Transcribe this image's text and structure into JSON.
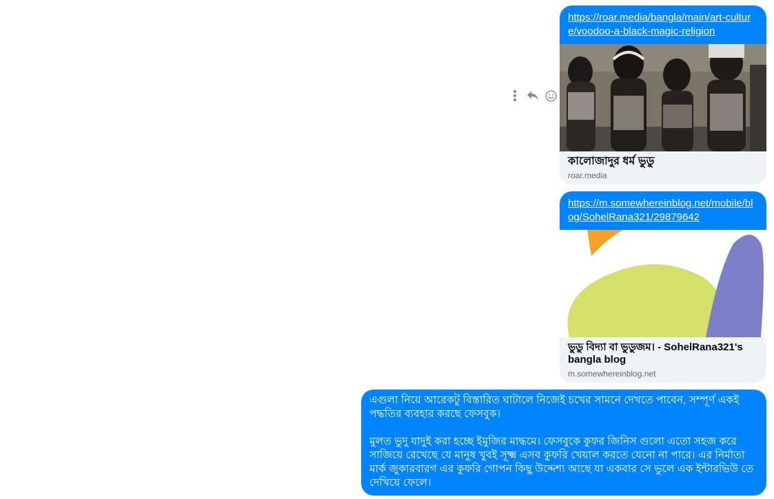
{
  "colors": {
    "bubble_blue": "#0084ff",
    "card_background": "#f0f2f5",
    "title_text": "#050505",
    "muted_text": "#65676b",
    "action_icon": "#8a8d91"
  },
  "message_actions": {
    "icons": [
      "more-options-icon",
      "reply-icon",
      "react-emoji-icon"
    ]
  },
  "messages": [
    {
      "type": "link_card",
      "url": "https://roar.media/bangla/main/art-culture/voodoo-a-black-magic-religion",
      "image": "voodoo-figurines-photo",
      "title": "কালোজাদুর ধর্ম ভুডু",
      "domain": "roar.media"
    },
    {
      "type": "link_card",
      "url": "https://m.somewhereinblog.net/mobile/blog/SohelRana321/29879642",
      "image": "somewhereinblog-logo-graphic",
      "title": "ভুডু বিদ্যা বা ভুডুজম। - SohelRana321's bangla blog",
      "domain": "m.somewhereinblog.net"
    },
    {
      "type": "text",
      "paragraphs": [
        "এগুলা নিয়ে আরেকটু বিস্তারিত ঘাটালে নিজেই চখের সামনে দেখতে পাবেন, সম্পূর্ণ একই পদ্ধতির ব্যবহার করছে ফেসবুক।",
        "মুলত ভুদু যাদুই করা হচ্ছে ইমুজির মাদ্ধমে। ফেসবুকে কুফর জিনিস গুলো এতো সহজ করে সাজিয়ে রেখেছে যে মানুষ খুবই সূক্ষ্ম এসব কুফরি খেয়াল করতে যেনো না পারে। এর নির্মাতা মার্ক জুকারবারগ এর কুফরি গোপন কিছু উদ্দেশ্য আছে যা একবার সে ভুলে এক ইন্টারভিউ তে দেখিয়ে ফেলে।"
      ]
    }
  ]
}
